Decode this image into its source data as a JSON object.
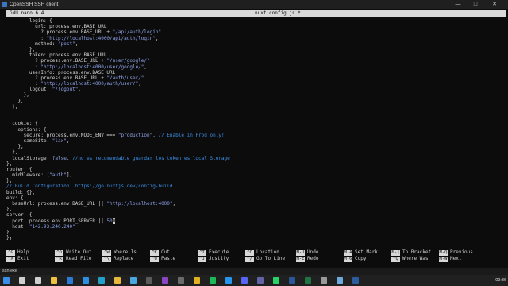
{
  "window": {
    "title": "OpenSSH SSH client"
  },
  "nano": {
    "version": "GNU nano 6.4",
    "filename": "nuxt.config.js *"
  },
  "editor": {
    "lines": [
      [
        {
          "t": "        login: {",
          "c": "k"
        }
      ],
      [
        {
          "t": "          url: process.env.BASE_URL",
          "c": "k"
        }
      ],
      [
        {
          "t": "            ? process.env.BASE_URL + ",
          "c": "k"
        },
        {
          "t": "\"/api/auth/login\"",
          "c": "s"
        }
      ],
      [
        {
          "t": "            : ",
          "c": "k"
        },
        {
          "t": "\"http://localhost:4000/api/auth/login\"",
          "c": "s"
        },
        {
          "t": ",",
          "c": "k"
        }
      ],
      [
        {
          "t": "          method: ",
          "c": "k"
        },
        {
          "t": "\"post\"",
          "c": "s"
        },
        {
          "t": ",",
          "c": "k"
        }
      ],
      [
        {
          "t": "        },",
          "c": "k"
        }
      ],
      [
        {
          "t": "        token: process.env.BASE_URL",
          "c": "k"
        }
      ],
      [
        {
          "t": "          ? process.env.BASE_URL + ",
          "c": "k"
        },
        {
          "t": "\"/user/google/\"",
          "c": "s"
        }
      ],
      [
        {
          "t": "          : ",
          "c": "k"
        },
        {
          "t": "\"http://localhost:4000/user/google/\"",
          "c": "s"
        },
        {
          "t": ",",
          "c": "k"
        }
      ],
      [
        {
          "t": "        userInfo: process.env.BASE_URL",
          "c": "k"
        }
      ],
      [
        {
          "t": "          ? process.env.BASE_URL + ",
          "c": "k"
        },
        {
          "t": "\"/auth/user/\"",
          "c": "s"
        }
      ],
      [
        {
          "t": "          : ",
          "c": "k"
        },
        {
          "t": "\"http://localhost:4000/auth/user/\"",
          "c": "s"
        },
        {
          "t": ",",
          "c": "k"
        }
      ],
      [
        {
          "t": "        logout: ",
          "c": "k"
        },
        {
          "t": "\"/logout\"",
          "c": "s"
        },
        {
          "t": ",",
          "c": "k"
        }
      ],
      [
        {
          "t": "      },",
          "c": "k"
        }
      ],
      [
        {
          "t": "    },",
          "c": "k"
        }
      ],
      [
        {
          "t": "  },",
          "c": "k"
        }
      ],
      [
        {
          "t": "",
          "c": "k"
        }
      ],
      [
        {
          "t": "",
          "c": "k"
        }
      ],
      [
        {
          "t": "  cookie: {",
          "c": "k"
        }
      ],
      [
        {
          "t": "    options: {",
          "c": "k"
        }
      ],
      [
        {
          "t": "      secure: process.env.NODE_ENV === ",
          "c": "k"
        },
        {
          "t": "\"production\"",
          "c": "s"
        },
        {
          "t": ", ",
          "c": "k"
        },
        {
          "t": "// Enable in Prod only!",
          "c": "c"
        }
      ],
      [
        {
          "t": "      sameSite: ",
          "c": "k"
        },
        {
          "t": "\"lax\"",
          "c": "s"
        },
        {
          "t": ",",
          "c": "k"
        }
      ],
      [
        {
          "t": "    },",
          "c": "k"
        }
      ],
      [
        {
          "t": "  },",
          "c": "k"
        }
      ],
      [
        {
          "t": "  localStorage: ",
          "c": "k"
        },
        {
          "t": "false",
          "c": "s"
        },
        {
          "t": ", ",
          "c": "k"
        },
        {
          "t": "//no es recomendable guardar los token es local Storage",
          "c": "c"
        }
      ],
      [
        {
          "t": "},",
          "c": "k"
        }
      ],
      [
        {
          "t": "router: {",
          "c": "k"
        }
      ],
      [
        {
          "t": "  middleware: [",
          "c": "k"
        },
        {
          "t": "\"auth\"",
          "c": "s"
        },
        {
          "t": "],",
          "c": "k"
        }
      ],
      [
        {
          "t": "},",
          "c": "k"
        }
      ],
      [
        {
          "t": "// Build Configuration: https://go.nuxtjs.dev/config-build",
          "c": "c"
        }
      ],
      [
        {
          "t": "build: {},",
          "c": "k"
        }
      ],
      [
        {
          "t": "env: {",
          "c": "k"
        }
      ],
      [
        {
          "t": "  baseUrl: process.env.BASE_URL || ",
          "c": "k"
        },
        {
          "t": "\"http://localhost:4000\"",
          "c": "s"
        },
        {
          "t": ",",
          "c": "k"
        }
      ],
      [
        {
          "t": "},",
          "c": "k"
        }
      ],
      [
        {
          "t": "server: {",
          "c": "k"
        }
      ],
      [
        {
          "t": "  port: process.env.PORT_SERVER || ",
          "c": "k"
        },
        {
          "t": "50",
          "c": "s"
        },
        {
          "t": "0",
          "c": "cursor"
        }
      ],
      [
        {
          "t": "  host: ",
          "c": "k"
        },
        {
          "t": "\"142.93.240.240\"",
          "c": "s"
        }
      ],
      [
        {
          "t": "}",
          "c": "k"
        }
      ],
      [
        {
          "t": "};",
          "c": "k"
        }
      ]
    ]
  },
  "shortcuts": [
    {
      "key": "^G",
      "label": "Help"
    },
    {
      "key": "^O",
      "label": "Write Out"
    },
    {
      "key": "^W",
      "label": "Where Is"
    },
    {
      "key": "^K",
      "label": "Cut"
    },
    {
      "key": "^T",
      "label": "Execute"
    },
    {
      "key": "^C",
      "label": "Location"
    },
    {
      "key": "M-U",
      "label": "Undo"
    },
    {
      "key": "M-A",
      "label": "Set Mark"
    },
    {
      "key": "M-]",
      "label": "To Bracket"
    },
    {
      "key": "M-Q",
      "label": "Previous"
    },
    {
      "key": "^X",
      "label": "Exit"
    },
    {
      "key": "^R",
      "label": "Read File"
    },
    {
      "key": "^\\",
      "label": "Replace"
    },
    {
      "key": "^U",
      "label": "Paste"
    },
    {
      "key": "^J",
      "label": "Justify"
    },
    {
      "key": "^/",
      "label": "Go To Line"
    },
    {
      "key": "M-E",
      "label": "Redo"
    },
    {
      "key": "M-6",
      "label": "Copy"
    },
    {
      "key": "^Q",
      "label": "Where Was"
    },
    {
      "key": "M-W",
      "label": "Next"
    }
  ],
  "statusline": {
    "text": "ssh.exe"
  },
  "taskbar": {
    "time": "09:36",
    "icons": [
      {
        "name": "windows-start-icon",
        "color": "#3b8ee8"
      },
      {
        "name": "search-icon",
        "color": "#cfcfcf"
      },
      {
        "name": "task-view-icon",
        "color": "#cfcfcf"
      },
      {
        "name": "file-explorer-icon",
        "color": "#f0c040"
      },
      {
        "name": "mail-icon",
        "color": "#2a7ad6"
      },
      {
        "name": "vscode-icon",
        "color": "#2d8fe0"
      },
      {
        "name": "edge-icon",
        "color": "#23a0c9"
      },
      {
        "name": "chrome-icon",
        "color": "#e8b83c"
      },
      {
        "name": "photos-icon",
        "color": "#4aa8e0"
      },
      {
        "name": "terminal-icon",
        "color": "#5a5a5a"
      },
      {
        "name": "onenote-icon",
        "color": "#8b45c2"
      },
      {
        "name": "terminal-2-icon",
        "color": "#6a6a6a"
      },
      {
        "name": "vpn-icon",
        "color": "#e0b020"
      },
      {
        "name": "spotify-icon",
        "color": "#1db954"
      },
      {
        "name": "docker-icon",
        "color": "#2496ed"
      },
      {
        "name": "discord-icon",
        "color": "#5865f2"
      },
      {
        "name": "teams-icon",
        "color": "#6264a7"
      },
      {
        "name": "whatsapp-icon",
        "color": "#25d366"
      },
      {
        "name": "word-icon",
        "color": "#2b579a"
      },
      {
        "name": "excel-icon",
        "color": "#217346"
      },
      {
        "name": "settings-icon",
        "color": "#9a9a9a"
      },
      {
        "name": "notepad-icon",
        "color": "#6fa8dc"
      },
      {
        "name": "powershell-icon",
        "color": "#2c5b9e"
      }
    ]
  }
}
